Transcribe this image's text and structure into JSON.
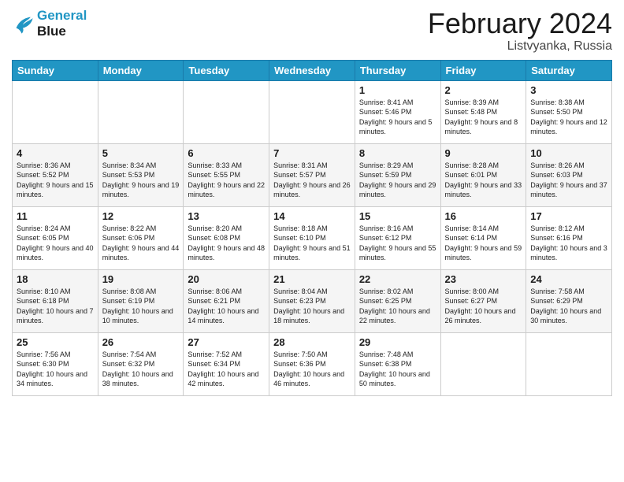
{
  "logo": {
    "line1": "General",
    "line2": "Blue"
  },
  "title": {
    "month_year": "February 2024",
    "location": "Listvyanka, Russia"
  },
  "weekdays": [
    "Sunday",
    "Monday",
    "Tuesday",
    "Wednesday",
    "Thursday",
    "Friday",
    "Saturday"
  ],
  "weeks": [
    [
      {
        "day": "",
        "info": ""
      },
      {
        "day": "",
        "info": ""
      },
      {
        "day": "",
        "info": ""
      },
      {
        "day": "",
        "info": ""
      },
      {
        "day": "1",
        "info": "Sunrise: 8:41 AM\nSunset: 5:46 PM\nDaylight: 9 hours\nand 5 minutes."
      },
      {
        "day": "2",
        "info": "Sunrise: 8:39 AM\nSunset: 5:48 PM\nDaylight: 9 hours\nand 8 minutes."
      },
      {
        "day": "3",
        "info": "Sunrise: 8:38 AM\nSunset: 5:50 PM\nDaylight: 9 hours\nand 12 minutes."
      }
    ],
    [
      {
        "day": "4",
        "info": "Sunrise: 8:36 AM\nSunset: 5:52 PM\nDaylight: 9 hours\nand 15 minutes."
      },
      {
        "day": "5",
        "info": "Sunrise: 8:34 AM\nSunset: 5:53 PM\nDaylight: 9 hours\nand 19 minutes."
      },
      {
        "day": "6",
        "info": "Sunrise: 8:33 AM\nSunset: 5:55 PM\nDaylight: 9 hours\nand 22 minutes."
      },
      {
        "day": "7",
        "info": "Sunrise: 8:31 AM\nSunset: 5:57 PM\nDaylight: 9 hours\nand 26 minutes."
      },
      {
        "day": "8",
        "info": "Sunrise: 8:29 AM\nSunset: 5:59 PM\nDaylight: 9 hours\nand 29 minutes."
      },
      {
        "day": "9",
        "info": "Sunrise: 8:28 AM\nSunset: 6:01 PM\nDaylight: 9 hours\nand 33 minutes."
      },
      {
        "day": "10",
        "info": "Sunrise: 8:26 AM\nSunset: 6:03 PM\nDaylight: 9 hours\nand 37 minutes."
      }
    ],
    [
      {
        "day": "11",
        "info": "Sunrise: 8:24 AM\nSunset: 6:05 PM\nDaylight: 9 hours\nand 40 minutes."
      },
      {
        "day": "12",
        "info": "Sunrise: 8:22 AM\nSunset: 6:06 PM\nDaylight: 9 hours\nand 44 minutes."
      },
      {
        "day": "13",
        "info": "Sunrise: 8:20 AM\nSunset: 6:08 PM\nDaylight: 9 hours\nand 48 minutes."
      },
      {
        "day": "14",
        "info": "Sunrise: 8:18 AM\nSunset: 6:10 PM\nDaylight: 9 hours\nand 51 minutes."
      },
      {
        "day": "15",
        "info": "Sunrise: 8:16 AM\nSunset: 6:12 PM\nDaylight: 9 hours\nand 55 minutes."
      },
      {
        "day": "16",
        "info": "Sunrise: 8:14 AM\nSunset: 6:14 PM\nDaylight: 9 hours\nand 59 minutes."
      },
      {
        "day": "17",
        "info": "Sunrise: 8:12 AM\nSunset: 6:16 PM\nDaylight: 10 hours\nand 3 minutes."
      }
    ],
    [
      {
        "day": "18",
        "info": "Sunrise: 8:10 AM\nSunset: 6:18 PM\nDaylight: 10 hours\nand 7 minutes."
      },
      {
        "day": "19",
        "info": "Sunrise: 8:08 AM\nSunset: 6:19 PM\nDaylight: 10 hours\nand 10 minutes."
      },
      {
        "day": "20",
        "info": "Sunrise: 8:06 AM\nSunset: 6:21 PM\nDaylight: 10 hours\nand 14 minutes."
      },
      {
        "day": "21",
        "info": "Sunrise: 8:04 AM\nSunset: 6:23 PM\nDaylight: 10 hours\nand 18 minutes."
      },
      {
        "day": "22",
        "info": "Sunrise: 8:02 AM\nSunset: 6:25 PM\nDaylight: 10 hours\nand 22 minutes."
      },
      {
        "day": "23",
        "info": "Sunrise: 8:00 AM\nSunset: 6:27 PM\nDaylight: 10 hours\nand 26 minutes."
      },
      {
        "day": "24",
        "info": "Sunrise: 7:58 AM\nSunset: 6:29 PM\nDaylight: 10 hours\nand 30 minutes."
      }
    ],
    [
      {
        "day": "25",
        "info": "Sunrise: 7:56 AM\nSunset: 6:30 PM\nDaylight: 10 hours\nand 34 minutes."
      },
      {
        "day": "26",
        "info": "Sunrise: 7:54 AM\nSunset: 6:32 PM\nDaylight: 10 hours\nand 38 minutes."
      },
      {
        "day": "27",
        "info": "Sunrise: 7:52 AM\nSunset: 6:34 PM\nDaylight: 10 hours\nand 42 minutes."
      },
      {
        "day": "28",
        "info": "Sunrise: 7:50 AM\nSunset: 6:36 PM\nDaylight: 10 hours\nand 46 minutes."
      },
      {
        "day": "29",
        "info": "Sunrise: 7:48 AM\nSunset: 6:38 PM\nDaylight: 10 hours\nand 50 minutes."
      },
      {
        "day": "",
        "info": ""
      },
      {
        "day": "",
        "info": ""
      }
    ]
  ]
}
